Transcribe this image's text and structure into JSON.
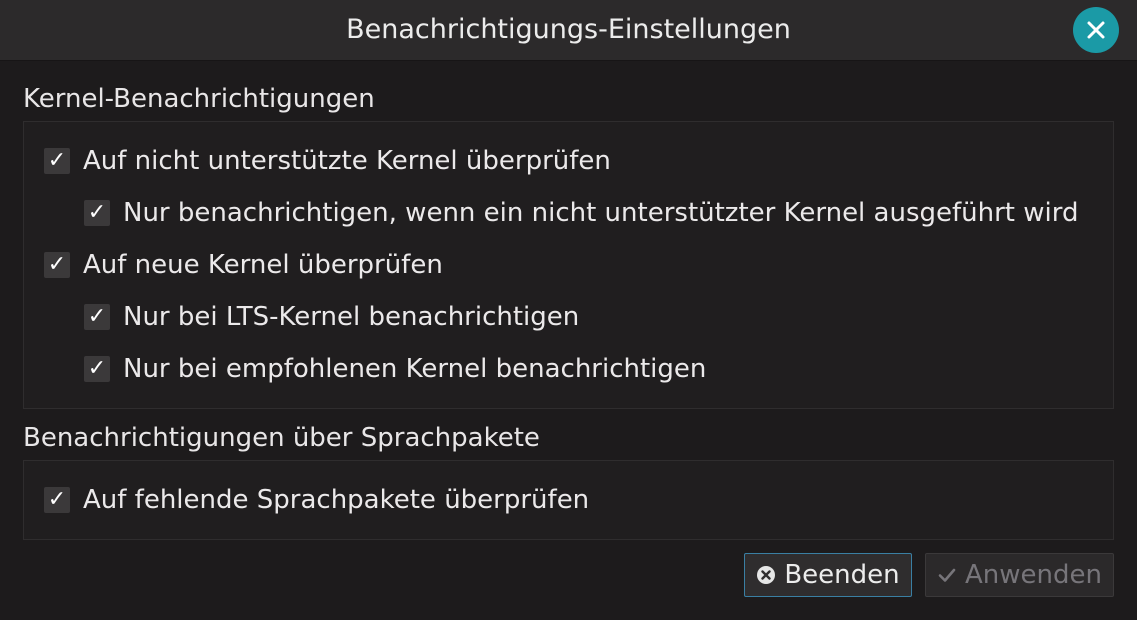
{
  "window": {
    "title": "Benachrichtigungs-Einstellungen"
  },
  "kernel_section": {
    "title": "Kernel-Benachrichtigungen",
    "options": [
      {
        "label": "Auf nicht unterstützte Kernel überprüfen",
        "checked": true,
        "level": 0
      },
      {
        "label": "Nur benachrichtigen, wenn ein nicht unterstützter Kernel ausgeführt wird",
        "checked": true,
        "level": 1
      },
      {
        "label": "Auf neue Kernel überprüfen",
        "checked": true,
        "level": 0
      },
      {
        "label": "Nur bei LTS-Kernel benachrichtigen",
        "checked": true,
        "level": 1
      },
      {
        "label": "Nur bei empfohlenen Kernel benachrichtigen",
        "checked": true,
        "level": 1
      }
    ]
  },
  "language_section": {
    "title": "Benachrichtigungen über Sprachpakete",
    "options": [
      {
        "label": "Auf fehlende Sprachpakete überprüfen",
        "checked": true,
        "level": 0
      }
    ]
  },
  "buttons": {
    "quit_label": "Beenden",
    "apply_label": "Anwenden",
    "apply_enabled": false
  },
  "icons": {
    "close": "close-icon",
    "check": "check-icon",
    "quit": "cancel-circle-icon",
    "apply": "checkmark-icon"
  },
  "colors": {
    "accent": "#1b9aa6",
    "focus_border": "#3a7fa3",
    "background": "#1d1b1c"
  }
}
